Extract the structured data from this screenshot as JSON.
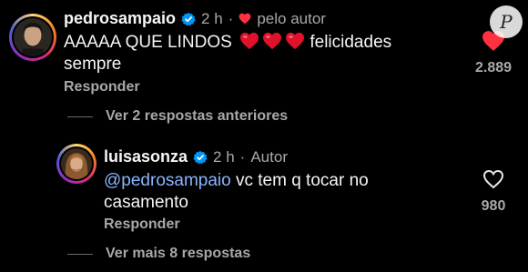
{
  "comment1": {
    "username": "pedrosampaio",
    "time": "2 h",
    "separator": "·",
    "liked_label": "pelo autor",
    "text_before": "AAAAA QUE LINDOS",
    "text_after": "felicidades sempre",
    "reply": "Responder",
    "likes": "2.889",
    "liked": true
  },
  "thread1": {
    "label": "Ver 2 respostas anteriores"
  },
  "comment2": {
    "username": "luisasonza",
    "time": "2 h",
    "separator": "·",
    "author_label": "Autor",
    "mention": "@pedrosampaio",
    "text": "vc tem q tocar no casamento",
    "reply": "Responder",
    "likes": "980",
    "liked": false
  },
  "thread2": {
    "label": "Ver mais 8 respostas"
  },
  "watermark": {
    "letter": "P"
  },
  "colors": {
    "background": "#000000",
    "heart_red": "#ff3040",
    "verified_blue": "#0095f6",
    "mention_blue": "#8ab4ff",
    "muted": "#a8a8a8"
  }
}
